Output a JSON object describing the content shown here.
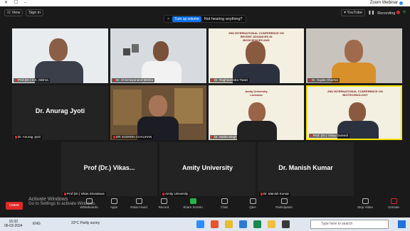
{
  "window": {
    "title": "Zoom Webinar",
    "controls": {
      "min": "–",
      "max": "☐",
      "close": "✕"
    }
  },
  "topbar": {
    "view_label": "View",
    "sign_in_label": "Sign in",
    "recording_label": "Recording",
    "youtube_label": "YouTube"
  },
  "banner": {
    "text": "Not hearing anything?",
    "button": "Turn up volume",
    "close": "×"
  },
  "tiles": [
    {
      "name": "Prof.(Dr.) K.K. Mishra",
      "muted": true
    },
    {
      "name": "Dr. Chinmayanand Mishra",
      "muted": true
    },
    {
      "name": "Dr. Raghavendra Tiwari",
      "muted": true
    },
    {
      "name": "Dr. Sujata Sharma",
      "muted": true
    },
    {
      "name": "Dr. Anurag Jyoti",
      "muted": true,
      "big_label": "Dr. Anurag Jyoti"
    },
    {
      "name": "DR SUSHMA CHAUHAN",
      "muted": true
    },
    {
      "name": "Dr. Sarita Singh",
      "muted": true
    },
    {
      "name": "Prof. (Dr.) Vinay Dwivedi",
      "muted": true
    },
    {
      "name": "Prof (Dr.) Vikas Srivastava",
      "muted": true,
      "big_label": "Prof (Dr.) Vikas..."
    },
    {
      "name": "Amity University",
      "muted": true,
      "big_label": "Amity University"
    },
    {
      "name": "Dr. Manish Kumar",
      "muted": true,
      "big_label": "Dr. Manish Kumar"
    }
  ],
  "conference_poster": {
    "line1": "2ND INTERNATIONAL CONFERENCE ON",
    "line2": "RECENT ADVANCES IN",
    "line3": "BIOSCIENCES AND",
    "line4": "BIOTECHNOLOGY",
    "line5": "Amity University",
    "line6": "Lucknow"
  },
  "toolbar": {
    "leave": "Leave",
    "items": [
      "Unmute",
      "Stop Video",
      "Participants",
      "Q&A",
      "Chat",
      "Share Screen",
      "Record",
      "Raise Hand",
      "Apps",
      "Whiteboards"
    ],
    "activate_title": "Activate Windows",
    "activate_sub": "Go to Settings to activate Windows."
  },
  "taskbar": {
    "search_placeholder": "Type here to search",
    "weather": "23°C Partly sunny",
    "time": "15:32",
    "date": "06-03-2024",
    "lang": "ENG"
  },
  "colors": {
    "accent": "#0e72ed",
    "leave": "#e02828",
    "share": "#27b34a",
    "active_speaker": "#f5e400"
  }
}
